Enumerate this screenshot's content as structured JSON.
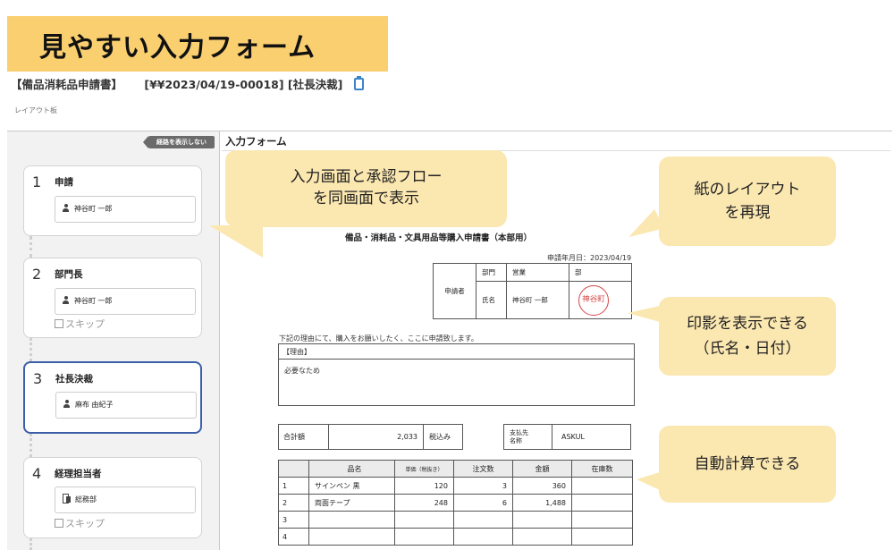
{
  "banner": {
    "text": "見やすい入力フォーム"
  },
  "header": {
    "doc_title": "【備品消耗品申請書】",
    "doc_id": "[¥¥2023/04/19-00018] [社長決裁]",
    "breadcrumb": "レイアウト板"
  },
  "sidebar": {
    "hide_route_label": "経路を表示しない",
    "steps": [
      {
        "number": "1",
        "title": "申請",
        "approver": "神谷町 一郎"
      },
      {
        "number": "2",
        "title": "部門長",
        "approver": "神谷町 一郎",
        "skip": "スキップ"
      },
      {
        "number": "3",
        "title": "社長決裁",
        "approver": "麻布 由紀子"
      },
      {
        "number": "4",
        "title": "経理担当者",
        "approver": "総務部",
        "skip": "スキップ"
      }
    ]
  },
  "form": {
    "section_title": "入力フォーム",
    "paper_title": "備品・消耗品・文具用品等購入申請書（本部用）",
    "apply_date": "申請年月日：2023/04/19",
    "applicant": {
      "row_label": "申請者",
      "dept_label": "部門",
      "dept_value": "営業",
      "suffix": "部",
      "name_label": "氏名",
      "name_value": "神谷町 一郎",
      "stamp": "神谷町"
    },
    "request_line": "下記の理由にて、購入をお願いしたく、ここに申請致します。",
    "reason_label": "【理由】",
    "reason_text": "必要なため",
    "totals": {
      "total_label": "合計額",
      "total_value": "2,033",
      "tax_label": "税込み",
      "supplier_label": "支払先\n名称",
      "supplier_value": "ASKUL"
    },
    "items": {
      "headers": {
        "name": "品名",
        "price": "単価（税抜き）",
        "qty": "注文数",
        "amount": "金額",
        "stock": "在庫数"
      },
      "rows": [
        {
          "no": "1",
          "name": "サインペン 黒",
          "price": "120",
          "qty": "3",
          "amount": "360",
          "stock": ""
        },
        {
          "no": "2",
          "name": "両面テープ",
          "price": "248",
          "qty": "6",
          "amount": "1,488",
          "stock": ""
        },
        {
          "no": "3",
          "name": "",
          "price": "",
          "qty": "",
          "amount": "",
          "stock": ""
        },
        {
          "no": "4",
          "name": "",
          "price": "",
          "qty": "",
          "amount": "",
          "stock": ""
        }
      ]
    }
  },
  "callouts": {
    "flow": "入力画面と承認フロー\nを同画面で表示",
    "paper": "紙のレイアウト\nを再現",
    "stamp": "印影を表示できる\n（氏名・日付）",
    "calc": "自動計算できる"
  },
  "colors": {
    "banner": "#f9cf70",
    "callout": "#fbe7b0",
    "active_step_border": "#3a5ea7",
    "stamp": "#d64545",
    "clip_icon": "#3b86c8"
  },
  "icons": [
    "clipboard-icon",
    "person-icon",
    "group-icon",
    "checkbox-icon"
  ]
}
